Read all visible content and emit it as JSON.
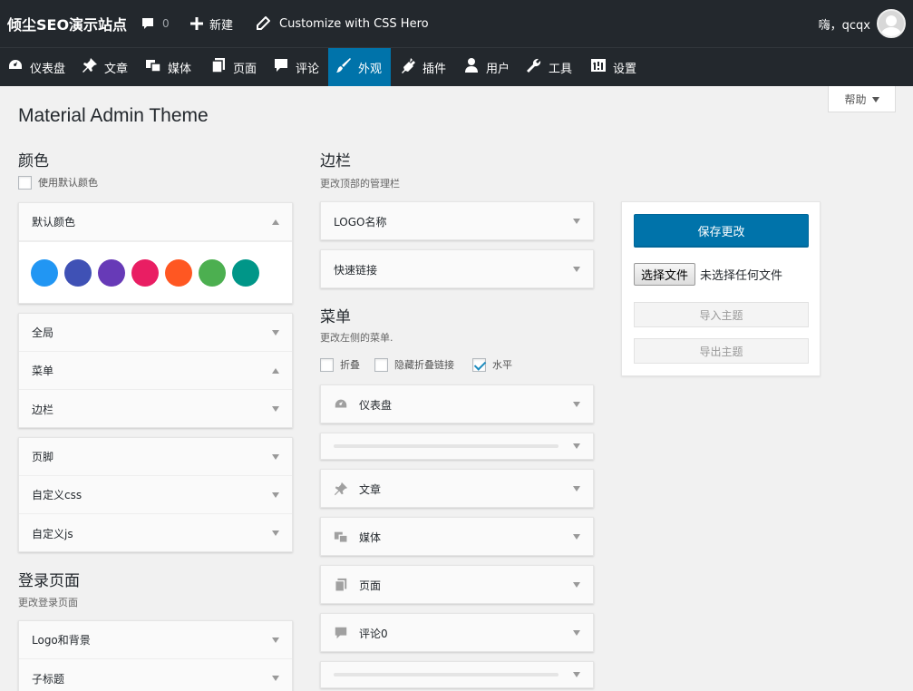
{
  "adminbar": {
    "site_name": "倾尘SEO演示站点",
    "comments_count": "0",
    "new_label": "新建",
    "css_hero_label": "Customize with CSS Hero",
    "greeting": "嗨，qcqx"
  },
  "menubar": {
    "items": [
      {
        "label": "仪表盘",
        "icon": "dashboard-icon"
      },
      {
        "label": "文章",
        "icon": "pin-icon"
      },
      {
        "label": "媒体",
        "icon": "media-icon"
      },
      {
        "label": "页面",
        "icon": "pages-icon"
      },
      {
        "label": "评论",
        "icon": "comment-icon"
      },
      {
        "label": "外观",
        "icon": "appearance-icon"
      },
      {
        "label": "插件",
        "icon": "plugin-icon"
      },
      {
        "label": "用户",
        "icon": "user-icon"
      },
      {
        "label": "工具",
        "icon": "wrench-icon"
      },
      {
        "label": "设置",
        "icon": "settings-icon"
      }
    ],
    "active": "外观"
  },
  "help_tab": "帮助",
  "page_title": "Material Admin Theme",
  "colors_section": {
    "title": "颜色",
    "use_default_label": "使用默认颜色",
    "default_colors_label": "默认颜色",
    "swatches": [
      "#2196f3",
      "#3f51b5",
      "#673ab7",
      "#e91e63",
      "#ff5722",
      "#4caf50",
      "#009688"
    ]
  },
  "left_accordion_1": [
    "全局",
    "菜单",
    "边栏"
  ],
  "left_accordion_2": [
    "页脚",
    "自定义css",
    "自定义js"
  ],
  "login_section": {
    "title": "登录页面",
    "desc": "更改登录页面",
    "items": [
      "Logo和背景",
      "子标题"
    ]
  },
  "sidebar_section": {
    "title": "边栏",
    "desc": "更改顶部的管理栏",
    "items": [
      "LOGO名称",
      "快速链接"
    ]
  },
  "menu_section": {
    "title": "菜单",
    "desc": "更改左侧的菜单.",
    "options": [
      {
        "label": "折叠",
        "checked": false
      },
      {
        "label": "隐藏折叠链接",
        "checked": false
      },
      {
        "label": "水平",
        "checked": true
      }
    ],
    "items": [
      "仪表盘",
      "",
      "文章",
      "媒体",
      "页面",
      "评论0",
      ""
    ]
  },
  "actions": {
    "save_label": "保存更改",
    "choose_file_label": "选择文件",
    "no_file_label": "未选择任何文件",
    "import_label": "导入主题",
    "export_label": "导出主题"
  },
  "colors": {
    "adminbar_bg": "#23282d",
    "accent": "#0073aa"
  }
}
